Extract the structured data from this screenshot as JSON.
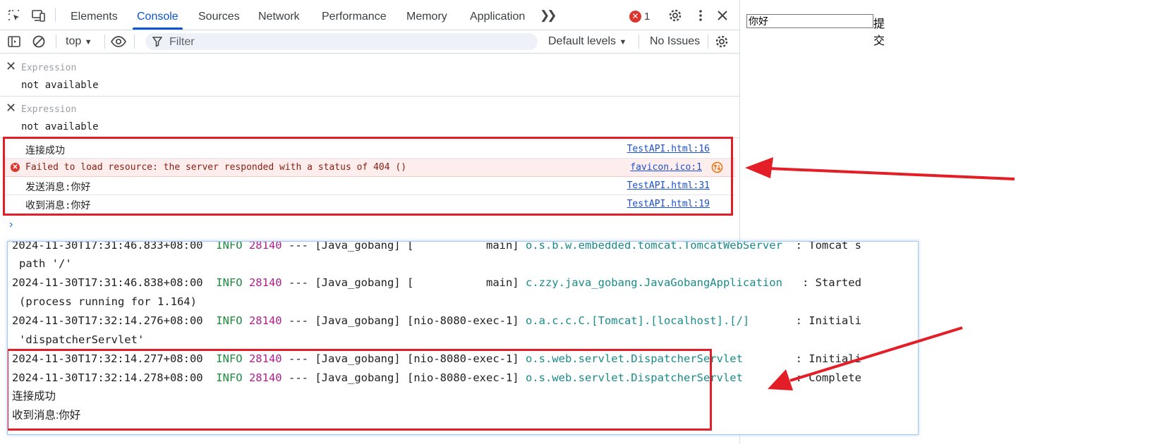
{
  "devtools": {
    "tabs": [
      "Elements",
      "Console",
      "Sources",
      "Network",
      "Performance",
      "Memory",
      "Application"
    ],
    "active_tab": "Console",
    "error_count": "1",
    "toolbar": {
      "context": "top",
      "filter_placeholder": "Filter",
      "levels": "Default levels",
      "issues": "No Issues"
    },
    "expressions": [
      {
        "label": "Expression",
        "value": "not available"
      },
      {
        "label": "Expression",
        "value": "not available"
      }
    ],
    "console_rows": [
      {
        "message": "连接成功",
        "source": "TestAPI.html:16",
        "type": "log"
      },
      {
        "message": "Failed to load resource: the server responded with a status of 404 ()",
        "source": "favicon.ico:1",
        "type": "error"
      },
      {
        "message": "发送消息:你好",
        "source": "TestAPI.html:31",
        "type": "log"
      },
      {
        "message": "收到消息:你好",
        "source": "TestAPI.html:19",
        "type": "log"
      }
    ],
    "prompt_symbol": "›"
  },
  "terminal": {
    "lines": [
      {
        "ts": "2024-11-30T17:31:46.833+08:00",
        "level": "INFO",
        "pid": "28140",
        "sep": "---",
        "app": "[Java_gobang]",
        "thread": "[           main]",
        "logger": "o.s.b.w.embedded.tomcat.TomcatWebServer ",
        "msg": ": Tomcat s",
        "cont": "path '/'"
      },
      {
        "ts": "2024-11-30T17:31:46.838+08:00",
        "level": "INFO",
        "pid": "28140",
        "sep": "---",
        "app": "[Java_gobang]",
        "thread": "[           main]",
        "logger": "c.zzy.java_gobang.JavaGobangApplication  ",
        "msg": ": Started ",
        "cont": "(process running for 1.164)"
      },
      {
        "ts": "2024-11-30T17:32:14.276+08:00",
        "level": "INFO",
        "pid": "28140",
        "sep": "---",
        "app": "[Java_gobang]",
        "thread": "[nio-8080-exec-1]",
        "logger": "o.a.c.c.C.[Tomcat].[localhost].[/]      ",
        "msg": ": Initiali",
        "cont": "'dispatcherServlet'"
      },
      {
        "ts": "2024-11-30T17:32:14.277+08:00",
        "level": "INFO",
        "pid": "28140",
        "sep": "---",
        "app": "[Java_gobang]",
        "thread": "[nio-8080-exec-1]",
        "logger": "o.s.web.servlet.DispatcherServlet       ",
        "msg": ": Initiali",
        "cont": ""
      },
      {
        "ts": "2024-11-30T17:32:14.278+08:00",
        "level": "INFO",
        "pid": "28140",
        "sep": "---",
        "app": "[Java_gobang]",
        "thread": "[nio-8080-exec-1]",
        "logger": "o.s.web.servlet.DispatcherServlet       ",
        "msg": ": Complete",
        "cont": ""
      }
    ],
    "plain_lines": [
      "连接成功",
      "收到消息:你好"
    ]
  },
  "page": {
    "input_value": "你好",
    "submit_label": "提交"
  },
  "colors": {
    "accent": "#0b57d0",
    "annotation_red": "#e41e26",
    "error_red": "#dc362e"
  }
}
